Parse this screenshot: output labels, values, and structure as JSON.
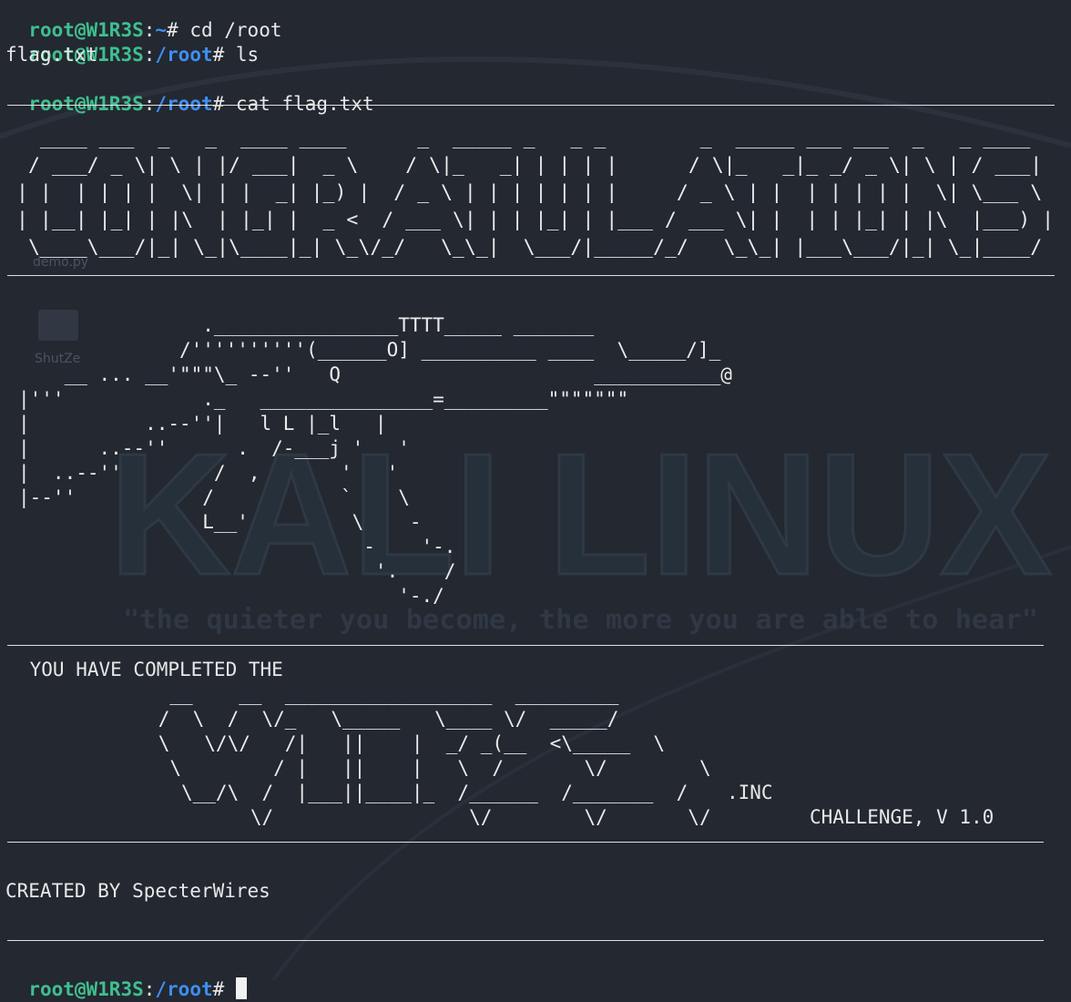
{
  "colors": {
    "background": "#232831",
    "prompt_user": "#3fbf8f",
    "prompt_path": "#3f8ef0",
    "text": "#e8e8e8"
  },
  "terminal": {
    "line1": {
      "user": "root@W1R3S",
      "sep": ":",
      "path": "~",
      "cmd": "# cd /root"
    },
    "line2": {
      "user": "root@W1R3S",
      "sep": ":",
      "path": "/root",
      "cmd": "# ls"
    },
    "line3": {
      "output": "flag.txt"
    },
    "line4": {
      "user": "root@W1R3S",
      "sep": ":",
      "path": "/root",
      "cmd": "# cat flag.txt"
    },
    "final_prompt": {
      "user": "root@W1R3S",
      "sep": ":",
      "path": "/root",
      "cmd": "# "
    }
  },
  "banner": {
    "congratulations_art": "  ____ ___  _   _  ____ ____      _  _____ _   _ _        _  _____ ___ ___  _   _ ____  \n / ___/ _ \\| \\ | |/ ___|  _ \\    / \\|_   _| | | | |      / \\|_   _|_ _/ _ \\| \\ | / ___| \n| |  | | | |  \\| | |  _| |_) |  / _ \\ | | | | | | |     / _ \\ | |  | | | | |  \\| \\___ \\ \n| |__| |_| | |\\  | |_| |  _ <  / ___ \\| | | |_| | |___ / ___ \\| |  | | |_| | |\\  |___) |\n \\____\\___/|_| \\_|\\____|_| \\_\\/_/   \\_\\_|  \\___/|_____/_/   \\_\\_| |___\\___/|_| \\_|____/ ",
    "gun_art": "                .________________TTTT_____ _______\n              /''''''''''(______O] __________ ____  \\_____/]_\n    __ ... __'\"\"\"\\_ --''   Q                      ___________@\n|'''            ._   _______________=_________\"\"\"\"\"\"\"\n|          ..--''|   l L |_l   |\n|      ..--''      .  /-___j '   '\n|  ..--''        /  ,       '   '\n|--''           /           `    \\\n                L__'         \\    -\n                              -    '-.\n                               '.    /\n                                 '-./",
    "completed_text": " YOU HAVE COMPLETED THE",
    "wires_art": "             __    __  __________________  _________\n            /  \\  /  \\/_   \\_____   \\____ \\/  _____/\n            \\   \\/\\/   /|   ||    |  _/ _(__  <\\_____  \\\n             \\        / |   ||    |   \\  /       \\/        \\\n              \\__/\\  /  |___||____|_  /______  /_______  /",
    "wires_inc": ".INC",
    "wires_arrows": "                    \\/                 \\/        \\/       \\/",
    "challenge_text": "CHALLENGE, V 1.0",
    "created_by": "CREATED BY SpecterWires"
  },
  "desktop_watermark": {
    "logo_text": "KALI LINUX",
    "tagline": "\"the quieter you become, the more you are able to hear\"",
    "icon_labels": [
      "demo.py",
      "ShutZe"
    ]
  }
}
